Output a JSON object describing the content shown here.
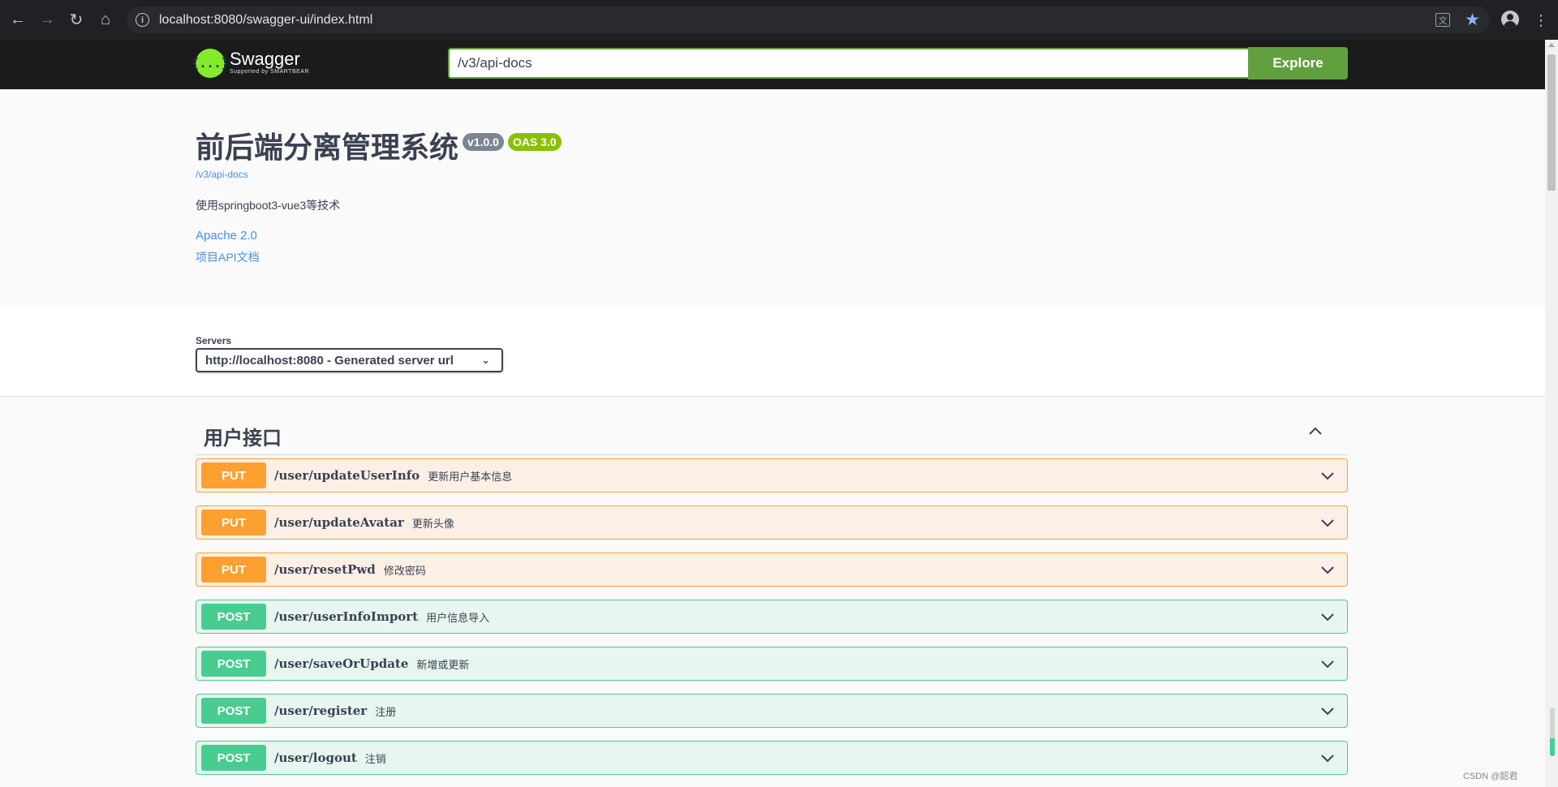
{
  "browser": {
    "url": "localhost:8080/swagger-ui/index.html"
  },
  "topbar": {
    "logo_title": "Swagger",
    "logo_sub": "Supported by SMARTBEAR",
    "logo_glyph": "{...}",
    "spec_url": "/v3/api-docs",
    "explore_label": "Explore",
    "accent_color": "#62a03f"
  },
  "info": {
    "title": "前后端分离管理系统",
    "version": "v1.0.0",
    "oas": "OAS 3.0",
    "spec_link": "/v3/api-docs",
    "description": "使用springboot3-vue3等技术",
    "license": "Apache 2.0",
    "docs_link": "项目API文档"
  },
  "servers": {
    "label": "Servers",
    "selected": "http://localhost:8080 - Generated server url"
  },
  "tag": {
    "name": "用户接口"
  },
  "operations": [
    {
      "method": "PUT",
      "path": "/user/updateUserInfo",
      "summary": "更新用户基本信息"
    },
    {
      "method": "PUT",
      "path": "/user/updateAvatar",
      "summary": "更新头像"
    },
    {
      "method": "PUT",
      "path": "/user/resetPwd",
      "summary": "修改密码"
    },
    {
      "method": "POST",
      "path": "/user/userInfoImport",
      "summary": "用户信息导入"
    },
    {
      "method": "POST",
      "path": "/user/saveOrUpdate",
      "summary": "新增或更新"
    },
    {
      "method": "POST",
      "path": "/user/register",
      "summary": "注册"
    },
    {
      "method": "POST",
      "path": "/user/logout",
      "summary": "注销"
    }
  ],
  "colors": {
    "put": "#fca130",
    "post": "#49cc90",
    "link": "#4990e2"
  },
  "watermark": "CSDN @韶君"
}
